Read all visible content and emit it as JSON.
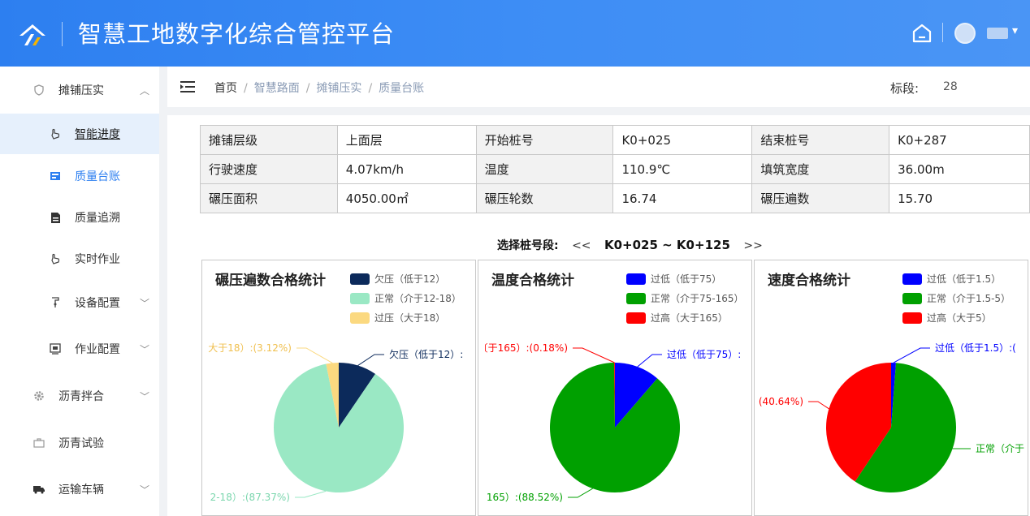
{
  "app": {
    "title": "智慧工地数字化综合管控平台"
  },
  "header": {
    "icons": [
      "logo-icon",
      "home-icon",
      "avatar",
      "username"
    ]
  },
  "sidebar": {
    "items": [
      {
        "label": "摊铺压实",
        "icon": "shield-icon",
        "expanded": true
      },
      {
        "label": "智能进度",
        "icon": "hand-icon",
        "active": true
      },
      {
        "label": "质量台账",
        "icon": "ledger-icon",
        "selected": true
      },
      {
        "label": "质量追溯",
        "icon": "document-icon"
      },
      {
        "label": "实时作业",
        "icon": "hand-icon"
      },
      {
        "label": "设备配置",
        "icon": "device-icon"
      },
      {
        "label": "作业配置",
        "icon": "monitor-icon"
      },
      {
        "label": "沥青拌合",
        "icon": "gear-icon"
      },
      {
        "label": "沥青试验",
        "icon": "briefcase-icon"
      },
      {
        "label": "运输车辆",
        "icon": "truck-icon"
      }
    ]
  },
  "breadcrumb": {
    "items": [
      "首页",
      "智慧路面",
      "摊铺压实",
      "质量台账"
    ],
    "sep": "/"
  },
  "section": {
    "label": "标段:",
    "value": "28"
  },
  "info_table": {
    "rows": [
      [
        "摊铺层级",
        "上面层",
        "开始桩号",
        "K0+025",
        "结束桩号",
        "K0+287"
      ],
      [
        "行驶速度",
        "4.07km/h",
        "温度",
        "110.9℃",
        "填筑宽度",
        "36.00m"
      ],
      [
        "碾压面积",
        "4050.00㎡",
        "碾压轮数",
        "16.74",
        "碾压遍数",
        "15.70"
      ]
    ]
  },
  "stake_selector": {
    "label": "选择桩号段:",
    "prev": "<<",
    "range": "K0+025 ~ K0+125",
    "next": ">>"
  },
  "chart_data": [
    {
      "type": "pie",
      "title": "碾压遍数合格统计",
      "categories": [
        "欠压（低于12）",
        "正常（介于12-18）",
        "过压（大于18）"
      ],
      "values": [
        9.51,
        87.37,
        3.12
      ],
      "colors": [
        "#0c2a5b",
        "#9ae8c4",
        "#fbd980"
      ],
      "labels": [
        "欠压（低于12）:",
        "2-18）:(87.37%)",
        "大于18）:(3.12%)"
      ]
    },
    {
      "type": "pie",
      "title": "温度合格统计",
      "categories": [
        "过低（低于75）",
        "正常（介于75-165）",
        "过高（大于165）"
      ],
      "values": [
        11.3,
        88.52,
        0.18
      ],
      "colors": [
        "#0000ff",
        "#00a000",
        "#ff0000"
      ],
      "labels": [
        "过低（低于75）:",
        "165）:(88.52%)",
        "〔于165）:(0.18%)"
      ]
    },
    {
      "type": "pie",
      "title": "速度合格统计",
      "categories": [
        "过低（低于1.5）",
        "正常（介于1.5-5）",
        "过高（大于5）"
      ],
      "values": [
        1.2,
        58.16,
        40.64
      ],
      "colors": [
        "#0000ff",
        "#00a000",
        "#ff0000"
      ],
      "labels": [
        "过低（低于1.5）:(",
        "正常（介于",
        "(40.64%)"
      ]
    }
  ]
}
